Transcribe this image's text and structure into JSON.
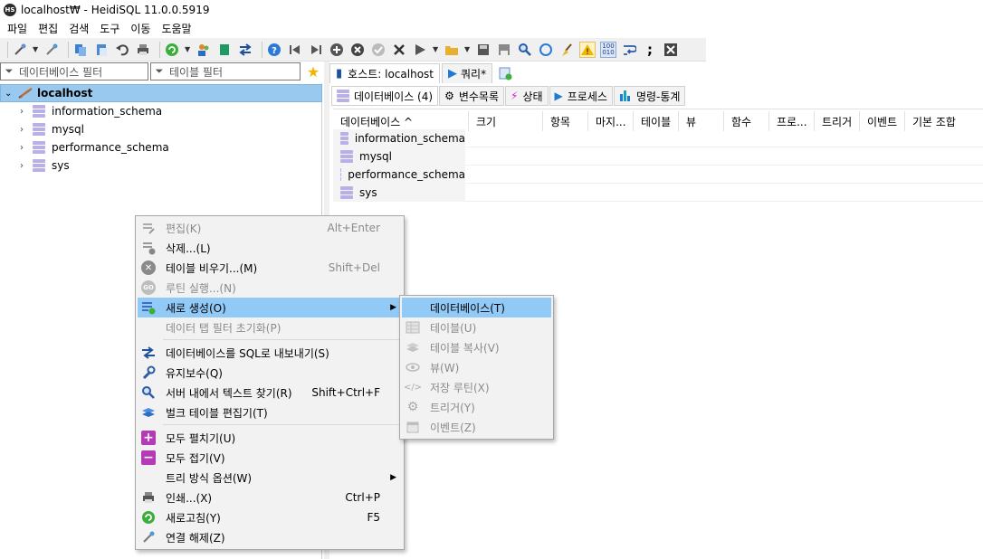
{
  "window": {
    "title": "localhost₩ - HeidiSQL 11.0.0.5919",
    "app_icon": "HS"
  },
  "menubar": [
    "파일",
    "편집",
    "검색",
    "도구",
    "이동",
    "도움말"
  ],
  "filters": {
    "db_filter": "데이터베이스 필터",
    "table_filter": "테이블 필터"
  },
  "tree": {
    "root": "localhost",
    "items": [
      "information_schema",
      "mysql",
      "performance_schema",
      "sys"
    ]
  },
  "main_tabs": [
    {
      "label": "호스트: localhost"
    },
    {
      "label": "쿼리*"
    }
  ],
  "sub_tabs": [
    {
      "label": "데이터베이스 (4)"
    },
    {
      "label": "변수목록"
    },
    {
      "label": "상태"
    },
    {
      "label": "프로세스"
    },
    {
      "label": "명령-통계"
    }
  ],
  "grid": {
    "headers": [
      "데이터베이스 ^",
      "크기",
      "항목",
      "마지...",
      "테이블",
      "뷰",
      "함수",
      "프로...",
      "트리거",
      "이벤트",
      "기본 조합"
    ],
    "rows": [
      "information_schema",
      "mysql",
      "performance_schema",
      "sys"
    ]
  },
  "context_menu": {
    "items": [
      {
        "label": "편집(K)",
        "shortcut": "Alt+Enter"
      },
      {
        "label": "삭제...(L)",
        "shortcut": ""
      },
      {
        "label": "테이블 비우기...(M)",
        "shortcut": "Shift+Del"
      },
      {
        "label": "루틴 실행...(N)",
        "shortcut": ""
      },
      {
        "label": "새로 생성(O)",
        "shortcut": ""
      },
      {
        "label": "데이터 탭 필터 초기화(P)",
        "shortcut": ""
      },
      {
        "label": "데이터베이스를 SQL로 내보내기(S)",
        "shortcut": ""
      },
      {
        "label": "유지보수(Q)",
        "shortcut": ""
      },
      {
        "label": "서버 내에서 텍스트 찾기(R)",
        "shortcut": "Shift+Ctrl+F"
      },
      {
        "label": "벌크 테이블 편집기(T)",
        "shortcut": ""
      },
      {
        "label": "모두 펼치기(U)",
        "shortcut": ""
      },
      {
        "label": "모두 접기(V)",
        "shortcut": ""
      },
      {
        "label": "트리 방식 옵션(W)",
        "shortcut": ""
      },
      {
        "label": "인쇄...(X)",
        "shortcut": "Ctrl+P"
      },
      {
        "label": "새로고침(Y)",
        "shortcut": "F5"
      },
      {
        "label": "연결 해제(Z)",
        "shortcut": ""
      }
    ]
  },
  "submenu": {
    "items": [
      {
        "label": "데이터베이스(T)"
      },
      {
        "label": "테이블(U)"
      },
      {
        "label": "테이블 복사(V)"
      },
      {
        "label": "뷰(W)"
      },
      {
        "label": "저장 루틴(X)"
      },
      {
        "label": "트리거(Y)"
      },
      {
        "label": "이벤트(Z)"
      }
    ]
  }
}
